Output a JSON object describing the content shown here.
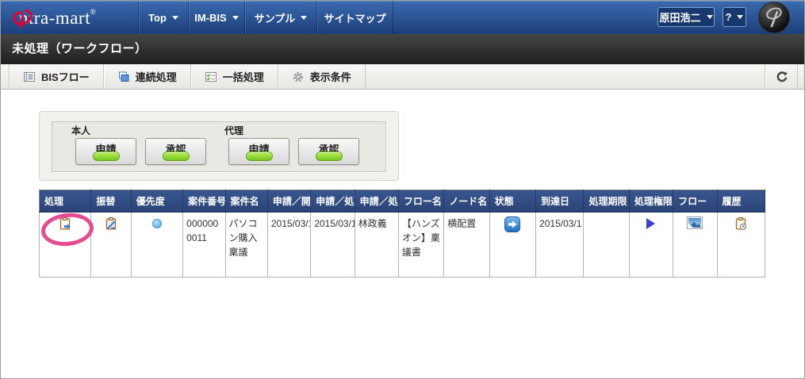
{
  "nav": {
    "logo_text": "intra-mart",
    "logo_reg": "®",
    "items": [
      {
        "label": "Top",
        "caret": true
      },
      {
        "label": "IM-BIS",
        "caret": true
      },
      {
        "label": "サンプル",
        "caret": true
      },
      {
        "label": "サイトマップ",
        "caret": false
      }
    ],
    "user_name": "原田浩二",
    "help_label": "?"
  },
  "title_bar": {
    "title": "未処理（ワークフロー）"
  },
  "toolbar": {
    "items": [
      {
        "label": "BISフロー",
        "icon": "list-icon"
      },
      {
        "label": "連続処理",
        "icon": "pages-icon"
      },
      {
        "label": "一括処理",
        "icon": "checklist-icon"
      },
      {
        "label": "表示条件",
        "icon": "gear-icon"
      }
    ],
    "refresh_icon": "refresh-icon"
  },
  "filter": {
    "groups": [
      {
        "label": "本人",
        "buttons": [
          {
            "label": "申請",
            "on": true
          },
          {
            "label": "承認",
            "on": true
          }
        ]
      },
      {
        "label": "代理",
        "buttons": [
          {
            "label": "申請",
            "on": true
          },
          {
            "label": "承認",
            "on": true
          }
        ]
      }
    ]
  },
  "table": {
    "columns": [
      "処理",
      "振替",
      "優先度",
      "案件番号",
      "案件名",
      "申請／開始日",
      "申請／処理日",
      "申請／処理者",
      "フロー名",
      "ノード名",
      "状態",
      "到達日",
      "処理期限",
      "処理権限",
      "フロー",
      "履歴"
    ],
    "rows": [
      {
        "process_icon": "clipboard-arrow-icon",
        "transfer_icon": "clipboard-edit-icon",
        "priority_icon": "blue-dot-icon",
        "case_number": "0000000011",
        "case_name": "パソコン購入稟議",
        "apply_start_date": "2015/03/1",
        "apply_process_date": "2015/03/1",
        "apply_processor": "林政義",
        "flow_name": "【ハンズオン】稟議書",
        "node_name": "横配置",
        "status_icon": "blue-arrow-right-icon",
        "arrival_date": "2015/03/1",
        "process_deadline": "",
        "authority_icon": "blue-triangle-icon",
        "flow_icon": "flow-image-icon",
        "history_icon": "clipboard-clock-icon"
      }
    ]
  },
  "annotation": {
    "shape": "ellipse",
    "color": "#e74a8e",
    "target": "process-icon"
  },
  "colors": {
    "nav_blue": "#1c3e78",
    "header_blue": "#2e4c85",
    "lamp_green": "#78c71c",
    "annotation_pink": "#e74a8e"
  }
}
